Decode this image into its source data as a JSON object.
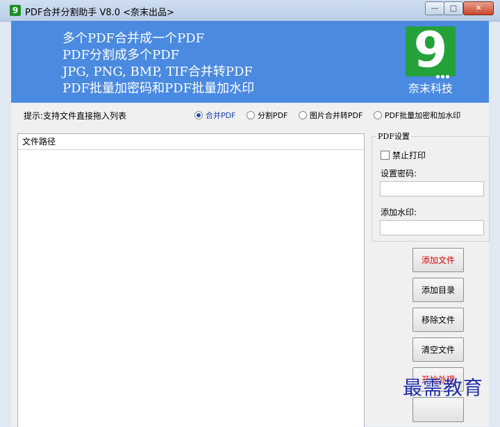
{
  "window": {
    "title": "PDF合并分割助手 V8.0 <奈末出品>",
    "app_icon_glyph": "9",
    "controls": {
      "minimize": "—",
      "maximize": "□",
      "close": "✕"
    }
  },
  "banner": {
    "lines": [
      "多个PDF合并成一个PDF",
      "PDF分割成多个PDF",
      "JPG, PNG, BMP, TIF合并转PDF",
      "PDF批量加密码和PDF批量加水印"
    ],
    "logo_glyph": "9",
    "logo_name": "奈末科技",
    "bg_color": "#4a8ae0",
    "logo_color": "#25a13a"
  },
  "hint": "提示:支持文件直接拖入列表",
  "modes": [
    {
      "label": "合并PDF",
      "checked": true
    },
    {
      "label": "分割PDF",
      "checked": false
    },
    {
      "label": "图片合并转PDF",
      "checked": false
    },
    {
      "label": "PDF批量加密和加水印",
      "checked": false
    }
  ],
  "file_list": {
    "column_header": "文件路径",
    "rows": []
  },
  "settings": {
    "legend": "PDF设置",
    "disable_print_label": "禁止打印",
    "disable_print_checked": false,
    "password_label": "设置密码:",
    "password_value": "",
    "watermark_label": "添加水印:",
    "watermark_value": ""
  },
  "buttons": {
    "add_file": "添加文件",
    "add_dir": "添加目录",
    "remove_file": "移除文件",
    "clear_files": "清空文件",
    "start": "开始处理"
  },
  "watermark_overlay": "最需教育"
}
